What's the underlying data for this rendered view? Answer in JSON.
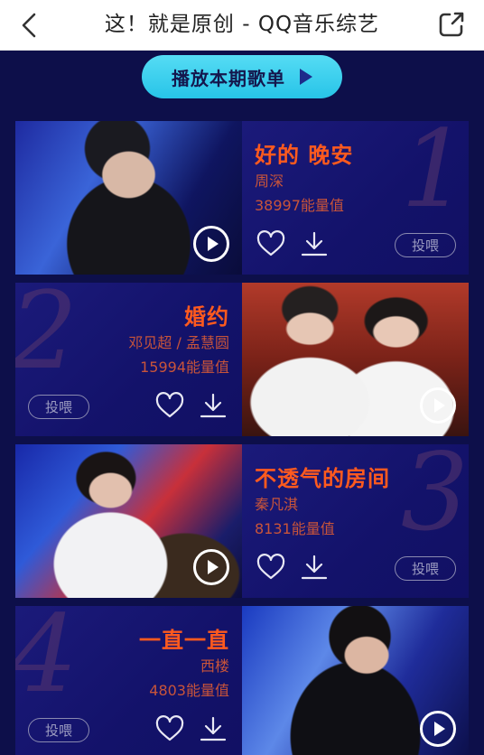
{
  "header": {
    "title": "这！就是原创 - QQ音乐综艺"
  },
  "play_button": {
    "label": "播放本期歌单"
  },
  "songs": [
    {
      "rank": "1",
      "title": "好的 晚安",
      "artist": "周深",
      "energy": "38997能量值",
      "feed_label": "投喂"
    },
    {
      "rank": "2",
      "title": "婚约",
      "artist": "邓见超 / 孟慧圆",
      "energy": "15994能量值",
      "feed_label": "投喂"
    },
    {
      "rank": "3",
      "title": "不透气的房间",
      "artist": "秦凡淇",
      "energy": "8131能量值",
      "feed_label": "投喂"
    },
    {
      "rank": "4",
      "title": "一直一直",
      "artist": "西楼",
      "energy": "4803能量值",
      "feed_label": "投喂"
    }
  ],
  "colors": {
    "background": "#0d0f4a",
    "accent_orange": "#ff5a1e",
    "play_button": "#3fd0ee"
  },
  "icons": [
    "back-arrow-icon",
    "share-icon",
    "play-triangle-icon",
    "heart-icon",
    "download-icon",
    "play-circle-icon"
  ]
}
